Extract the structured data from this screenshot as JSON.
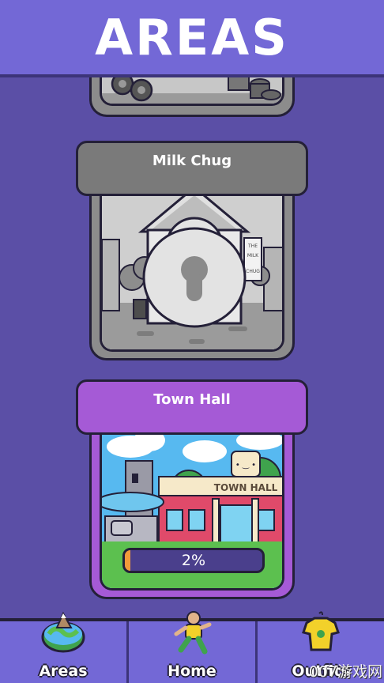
{
  "header": {
    "title": "AREAS"
  },
  "areas": [
    {
      "name": "Milk Chug",
      "locked": true,
      "sign_text": "THE MILK CHUG"
    },
    {
      "name": "Town Hall",
      "locked": false,
      "progress_label": "2%",
      "progress_fraction": 0.02,
      "building_sign": "TOWN HALL"
    }
  ],
  "tabs": [
    {
      "label": "Areas",
      "icon": "globe-icon"
    },
    {
      "label": "Home",
      "icon": "runner-icon"
    },
    {
      "label": "Outfits",
      "icon": "shirt-icon"
    }
  ],
  "watermark": "007游戏网",
  "colors": {
    "header": "#7368d6",
    "background": "#5b4fa6",
    "town_hall_banner": "#a55ad6",
    "locked_banner": "#7a7a7a",
    "progress": "#f29a3a"
  }
}
